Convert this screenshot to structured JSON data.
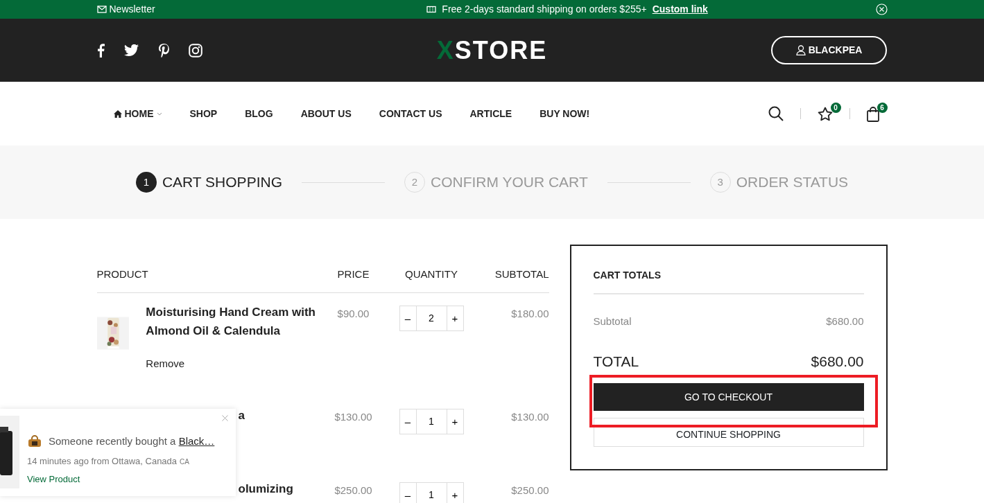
{
  "top_bar": {
    "newsletter": "Newsletter",
    "promo": "Free 2-days standard shipping on orders $255+",
    "promo_link": "Custom link"
  },
  "header": {
    "logo_accent": "X",
    "logo_rest": "STORE",
    "account": "BLACKPEA"
  },
  "nav": {
    "items": [
      {
        "label": "HOME",
        "kind": "home"
      },
      {
        "label": "SHOP",
        "kind": "plain"
      },
      {
        "label": "BLOG",
        "kind": "plain"
      },
      {
        "label": "ABOUT US",
        "kind": "plain"
      },
      {
        "label": "CONTACT US",
        "kind": "plain"
      },
      {
        "label": "ARTICLE",
        "kind": "plain"
      },
      {
        "label": "BUY NOW!",
        "kind": "plain"
      }
    ],
    "wishlist_count": "0",
    "cart_count": "6"
  },
  "steps": [
    {
      "number": "1",
      "label": "CART SHOPPING",
      "selected": true
    },
    {
      "number": "2",
      "label": "CONFIRM YOUR CART",
      "selected": false
    },
    {
      "number": "3",
      "label": "ORDER STATUS",
      "selected": false
    }
  ],
  "cart": {
    "columns": [
      "PRODUCT",
      "PRICE",
      "QUANTITY",
      "SUBTOTAL"
    ],
    "rows": [
      {
        "kind": "full",
        "name": "Moisturising Hand Cream with Almond Oil & Calendula",
        "remove": "Remove",
        "price": "$90.00",
        "minus": "–",
        "quantity": "2",
        "plus": "+",
        "subtotal": "$180.00"
      },
      {
        "kind": "partial",
        "name": "a",
        "price": "$130.00",
        "minus": "–",
        "quantity": "1",
        "plus": "+",
        "subtotal": "$130.00"
      },
      {
        "kind": "partial",
        "name": "olumizing",
        "price": "$250.00",
        "minus": "–",
        "quantity": "1",
        "plus": "+",
        "subtotal": "$250.00"
      }
    ]
  },
  "totals": {
    "title": "CART TOTALS",
    "subtotal_label": "Subtotal",
    "subtotal": "$680.00",
    "total_label": "TOTAL",
    "total": "$680.00",
    "checkout": "GO TO CHECKOUT",
    "continue": "CONTINUE SHOPPING",
    "checkout_highlighted": true
  },
  "popup": {
    "text_before": "Someone recently bought a ",
    "product_link": "Black…",
    "when": "14 minutes ago from Ottawa, Canada",
    "country": "CA",
    "view": "View Product"
  }
}
